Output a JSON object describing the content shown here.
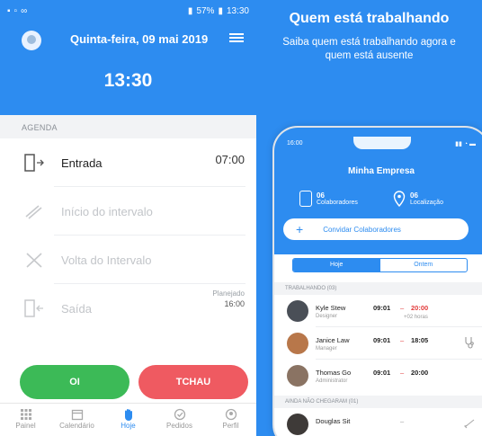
{
  "left": {
    "status_bar": {
      "battery": "57%",
      "time": "13:30"
    },
    "header": {
      "date": "Quinta-feira, 09 mai 2019",
      "clock": "13:30"
    },
    "agenda": {
      "section_label": "AGENDA",
      "items": [
        {
          "label": "Entrada",
          "value": "07:00",
          "active": true
        },
        {
          "label": "Início do intervalo",
          "value": "",
          "active": false
        },
        {
          "label": "Volta do Intervalo",
          "value": "",
          "active": false
        },
        {
          "label": "Saída",
          "planned_label": "Planejado",
          "planned_time": "16:00",
          "active": false
        }
      ]
    },
    "buttons": {
      "oi": "OI",
      "tchau": "TCHAU"
    },
    "tabs": [
      {
        "label": "Painel",
        "icon": "grid-icon"
      },
      {
        "label": "Calendário",
        "icon": "calendar-icon"
      },
      {
        "label": "Hoje",
        "icon": "hand-icon",
        "active": true
      },
      {
        "label": "Pedidos",
        "icon": "check-circle-icon"
      },
      {
        "label": "Perfil",
        "icon": "user-icon"
      }
    ]
  },
  "right": {
    "title": "Quem está trabalhando",
    "subtitle_line1": "Saiba quem está trabalhando agora e",
    "subtitle_line2": "quem está ausente",
    "phone": {
      "time": "16:00",
      "company": "Minha Empresa",
      "collaborators_count": "06",
      "collaborators_label": "Colaboradores",
      "locations_count": "06",
      "locations_label": "Localização",
      "invite_label": "Convidar Colaboradores",
      "tabs": [
        "Hoje",
        "Ontem"
      ],
      "working_section": "TRABALHANDO (03)",
      "working": [
        {
          "name": "Kyle Stew",
          "role": "Designer",
          "start": "09:01",
          "end": "20:00",
          "extra": "+02 horas",
          "end_color": "#e23b3b"
        },
        {
          "name": "Janice Law",
          "role": "Manager",
          "start": "09:01",
          "end": "18:05",
          "extra": "",
          "end_color": "#222222"
        },
        {
          "name": "Thomas Go",
          "role": "Administrator",
          "start": "09:01",
          "end": "20:00",
          "extra": "",
          "end_color": "#222222"
        }
      ],
      "absent_section": "AINDA NÃO CHEGARAM (01)",
      "absent": [
        {
          "name": "Douglas Sit"
        }
      ]
    }
  },
  "colors": {
    "primary": "#2d8cf0",
    "green": "#3cba57",
    "red": "#ef5a61"
  }
}
